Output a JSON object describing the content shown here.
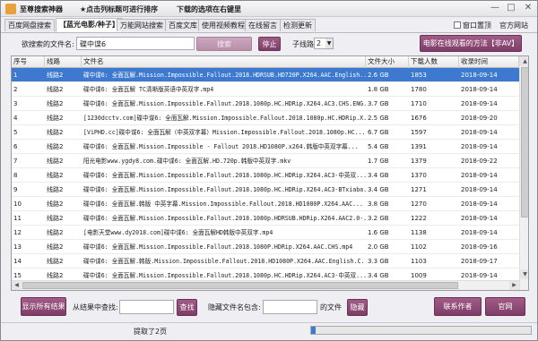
{
  "titlebar": {
    "title": "至尊搜索神器",
    "hint_sort": "★点击列标题可进行排序",
    "hint_download": "下载的选项在右键里",
    "minimize": "—",
    "maximize": "□",
    "close": "✕"
  },
  "tabs": [
    {
      "label": "百度网盘搜索"
    },
    {
      "label": "【蓝光电影/种子】"
    },
    {
      "label": "万能网站搜索"
    },
    {
      "label": "百度文库"
    },
    {
      "label": "使用视频教程"
    },
    {
      "label": "在线留言"
    },
    {
      "label": "检测更新"
    }
  ],
  "options": {
    "topmost_label": "窗口置顶",
    "official_label": "官方网站"
  },
  "search": {
    "label": "欲搜索的文件名:",
    "value": "碟中谍6",
    "search_button": "搜索",
    "stop_button": "停止",
    "subline_label": "子线路",
    "subline_value": "2",
    "movie_button": "电影在线观看的方法【非AV】"
  },
  "table": {
    "columns": [
      "序号",
      "线路",
      "文件名",
      "文件大小",
      "下载人数",
      "收录时间"
    ],
    "rows": [
      {
        "no": "1",
        "line": "线路2",
        "name": "碟中谍6: 全面瓦解.Mission.Impossible.Fallout.2018.HDRSUB.HD720P.X264.AAC.English...",
        "size": "2.6 GB",
        "dl": "1853",
        "time": "2018-09-14"
      },
      {
        "no": "2",
        "line": "线路2",
        "name": "碟中谍6: 全面瓦解 TC清晰版英语中英双字.mp4",
        "size": "1.8 GB",
        "dl": "1780",
        "time": "2018-09-14"
      },
      {
        "no": "3",
        "line": "线路2",
        "name": "碟中谍6: 全面瓦解.Mission.Impossible.Fallout.2018.1080p.HC.HDRip.X264.AC3.CHS.ENG...",
        "size": "3.7 GB",
        "dl": "1710",
        "time": "2018-09-14"
      },
      {
        "no": "4",
        "line": "线路2",
        "name": "[1230dcctv.com]碟中谍6: 全面瓦解.Mission.Impossible.Fallout.2018.1080p.HC.HDRip.X...",
        "size": "2.5 GB",
        "dl": "1676",
        "time": "2018-09-20"
      },
      {
        "no": "5",
        "line": "线路2",
        "name": "[ViPHD.cc]碟中谍6: 全面瓦解（中英双字幕）Mission.Impossible.Fallout.2018.1080p.HC...",
        "size": "6.7 GB",
        "dl": "1597",
        "time": "2018-09-14"
      },
      {
        "no": "6",
        "line": "线路2",
        "name": "碟中谍6: 全面瓦解.Mission.Impossible - Fallout 2018.HD1080P.x264.韩版中英双字幕...",
        "size": "5.4 GB",
        "dl": "1391",
        "time": "2018-09-14"
      },
      {
        "no": "7",
        "line": "线路2",
        "name": "阳光电影www.ygdy8.com.碟中谍6: 全面瓦解.HD.720p.韩版中英双字.mkv",
        "size": "1.7 GB",
        "dl": "1379",
        "time": "2018-09-22"
      },
      {
        "no": "8",
        "line": "线路2",
        "name": "碟中谍6: 全面瓦解.Mission.Impossible.Fallout.2018.1080p.HC.HDRip.X264.AC3-中英双...",
        "size": "3.4 GB",
        "dl": "1370",
        "time": "2018-09-14"
      },
      {
        "no": "9",
        "line": "线路2",
        "name": "碟中谍6: 全面瓦解.Mission.Impossible.Fallout.2018.1080p.HC.HDRip.X264.AC3-BTxiaba...",
        "size": "3.4 GB",
        "dl": "1271",
        "time": "2018-09-14"
      },
      {
        "no": "10",
        "line": "线路2",
        "name": "碟中谍6: 全面瓦解.韩版 中英字幕.Mission.Impossible.Fallout.2018.HD1080P.X264.AAC...",
        "size": "3.8 GB",
        "dl": "1270",
        "time": "2018-09-14"
      },
      {
        "no": "11",
        "line": "线路2",
        "name": "碟中谍6: 全面瓦解.Mission.Impossible.Fallout.2018.1080p.HDRSUB.HDRip.X264.AAC2.0-...",
        "size": "3.2 GB",
        "dl": "1222",
        "time": "2018-09-14"
      },
      {
        "no": "12",
        "line": "线路2",
        "name": "[电影天堂www.dy2018.com]碟中谍6: 全面瓦解HD韩版中英双字.mp4",
        "size": "1.6 GB",
        "dl": "1138",
        "time": "2018-09-14"
      },
      {
        "no": "13",
        "line": "线路2",
        "name": "碟中谍6: 全面瓦解.Mission.Impossible.Fallout.2018.1080P.HDRip.X264.AAC.CHS.mp4",
        "size": "2.0 GB",
        "dl": "1102",
        "time": "2018-09-16"
      },
      {
        "no": "14",
        "line": "线路2",
        "name": "碟中谍6: 全面瓦解.韩版.Mission.Impossible.Fallout.2018.HD1080P.X264.AAC.English.C...",
        "size": "3.3 GB",
        "dl": "1103",
        "time": "2018-09-17"
      },
      {
        "no": "15",
        "line": "线路2",
        "name": "碟中谍6: 全面瓦解.Mission.Impossible.Fallout.2018.1080p.HC.HDRip.X264.AC3-中英双...",
        "size": "3.4 GB",
        "dl": "1009",
        "time": "2018-09-14"
      }
    ]
  },
  "bottom": {
    "show_all_button": "显示所有结果",
    "find_label": "从结果中查找:",
    "find_value": "",
    "find_button": "查找",
    "hide_label": "隐藏文件名包含:",
    "hide_value": "",
    "files_label": "的文件",
    "hide_button": "隐藏",
    "contact_button": "联系作者",
    "site_button": "官网"
  },
  "status": {
    "text": "提取了2页",
    "progress": 0.02
  },
  "colors": {
    "accent": "#8a4673",
    "selection": "#3c79cf"
  }
}
